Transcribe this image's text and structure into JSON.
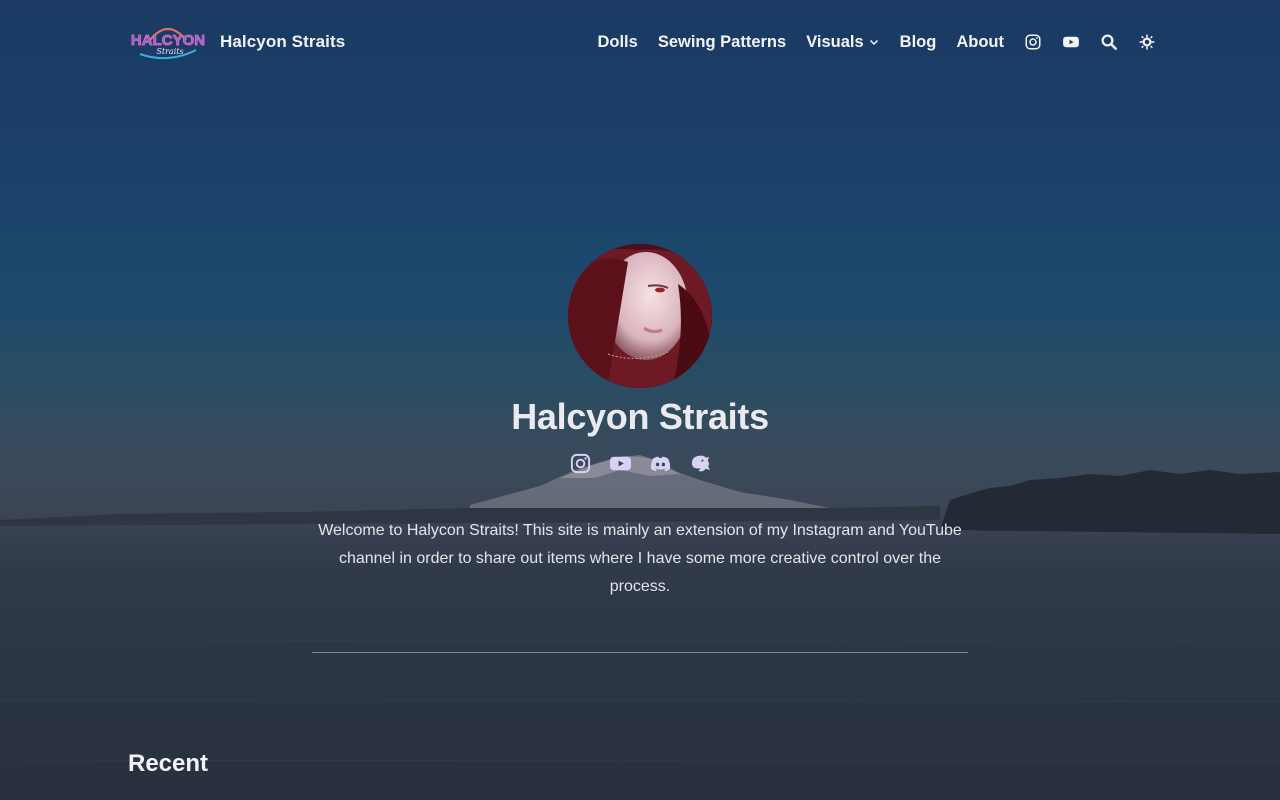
{
  "site": {
    "logo_text": "HALCYON",
    "logo_subtext": "Straits",
    "title": "Halcyon Straits"
  },
  "nav": {
    "items": [
      {
        "label": "Dolls"
      },
      {
        "label": "Sewing Patterns"
      },
      {
        "label": "Visuals",
        "has_dropdown": true
      },
      {
        "label": "Blog"
      },
      {
        "label": "About"
      }
    ],
    "icons": [
      "instagram-icon",
      "youtube-icon",
      "search-icon",
      "theme-toggle-icon"
    ]
  },
  "profile": {
    "name": "Halcyon Straits",
    "social_icons": [
      "instagram-icon",
      "youtube-icon",
      "discord-icon",
      "mastodon-icon"
    ],
    "bio": "Welcome to Halycon Straits! This site is mainly an extension of my Instagram and YouTube channel in order to share out items where I have some more creative control over the process."
  },
  "sections": {
    "recent_title": "Recent"
  },
  "colors": {
    "icon_accent": "#d8d2f2",
    "text": "#f4f4f8",
    "sky": "#1a3a63",
    "water": "#28303d"
  }
}
